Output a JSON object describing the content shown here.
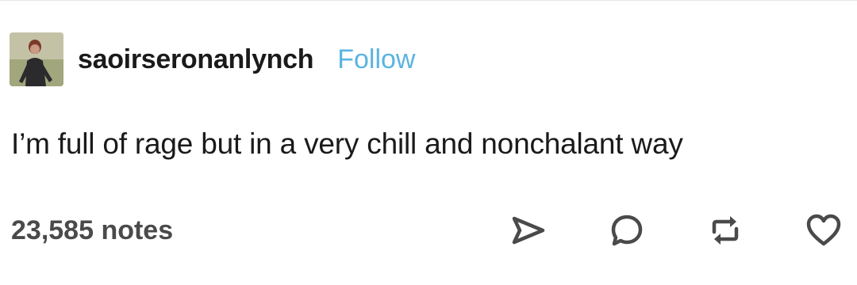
{
  "post": {
    "author": {
      "username": "saoirseronanlynch",
      "avatar_icon": "profile-photo"
    },
    "follow_label": "Follow",
    "text": "I’m full of rage but in a very chill and nonchalant way",
    "notes_label": "23,585 notes",
    "actions": [
      {
        "icon": "share-icon"
      },
      {
        "icon": "reply-icon"
      },
      {
        "icon": "reblog-icon"
      },
      {
        "icon": "like-icon"
      }
    ]
  },
  "colors": {
    "accent": "#5bb4e0",
    "text": "#1a1a1a",
    "muted": "#4a4a4a",
    "icon": "#4a4a4a"
  }
}
